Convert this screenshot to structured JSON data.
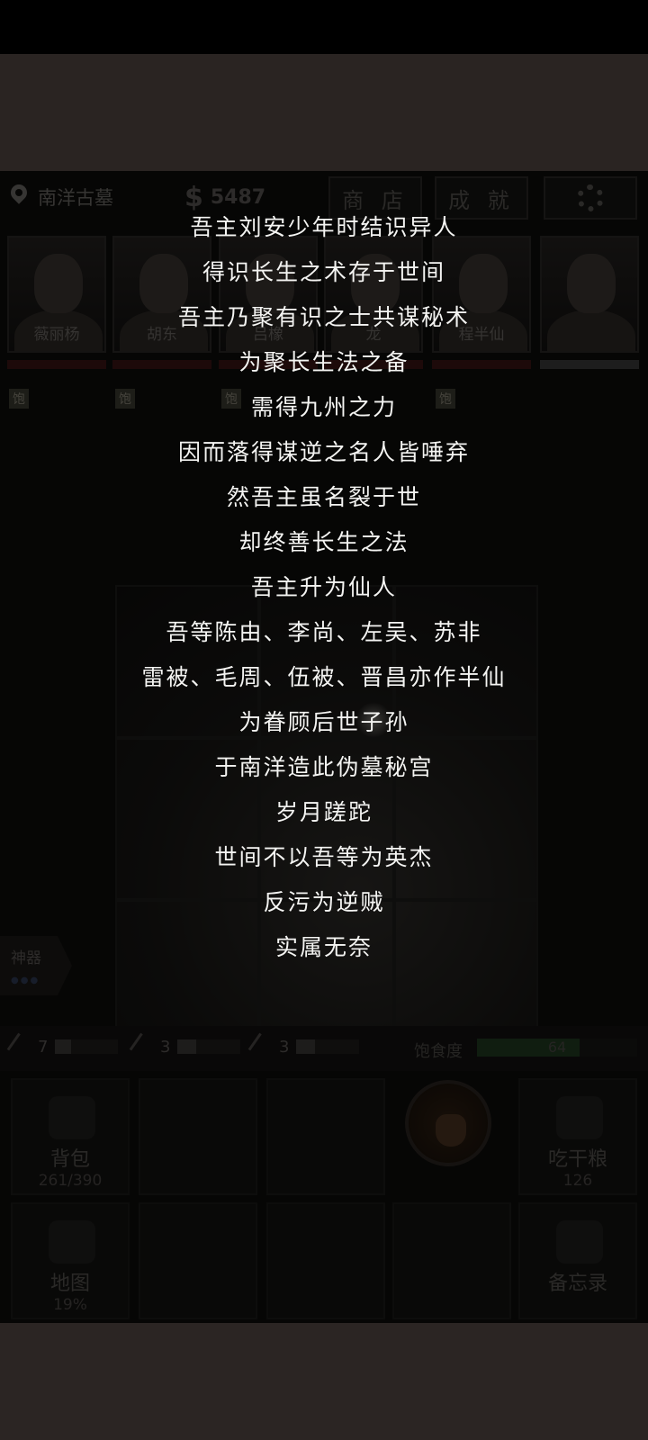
{
  "header": {
    "location": "南洋古墓",
    "money": "5487",
    "shop_label": "商 店",
    "achievements_label": "成 就",
    "settings_icon": "gear-icon"
  },
  "party": [
    {
      "name": "薇丽杨",
      "status": "饱"
    },
    {
      "name": "胡东",
      "status": "饱"
    },
    {
      "name": "吕橡",
      "status": "饱"
    },
    {
      "name": "龙",
      "status": ""
    },
    {
      "name": "程半仙",
      "status": "饱"
    },
    {
      "name": "",
      "status": ""
    }
  ],
  "artifact": {
    "label": "神器"
  },
  "stats": {
    "tool1": "7",
    "tool2": "3",
    "tool3": "3",
    "hunger_label": "饱食度",
    "hunger_value": "64",
    "hunger_fraction": 0.64
  },
  "actions": {
    "bag_label": "背包",
    "bag_value": "261/390",
    "eat_label": "吃干粮",
    "eat_value": "126",
    "map_label": "地图",
    "map_value": "19%",
    "memo_label": "备忘录"
  },
  "story_lines": [
    "吾主刘安少年时结识异人",
    "得识长生之术存于世间",
    "吾主乃聚有识之士共谋秘术",
    "为聚长生法之备",
    "需得九州之力",
    "因而落得谋逆之名人皆唾弃",
    "然吾主虽名裂于世",
    "却终善长生之法",
    "吾主升为仙人",
    "吾等陈由、李尚、左吴、苏非",
    "雷被、毛周、伍被、晋昌亦作半仙",
    "为眷顾后世子孙",
    "于南洋造此伪墓秘宫",
    "岁月蹉跎",
    "世间不以吾等为英杰",
    "反污为逆贼",
    "实属无奈"
  ],
  "colors": {
    "text": "#f4f4f2",
    "background": "#0d0c0b",
    "hp_bar": "#3a1414",
    "hunger_bar": "#203a20"
  }
}
